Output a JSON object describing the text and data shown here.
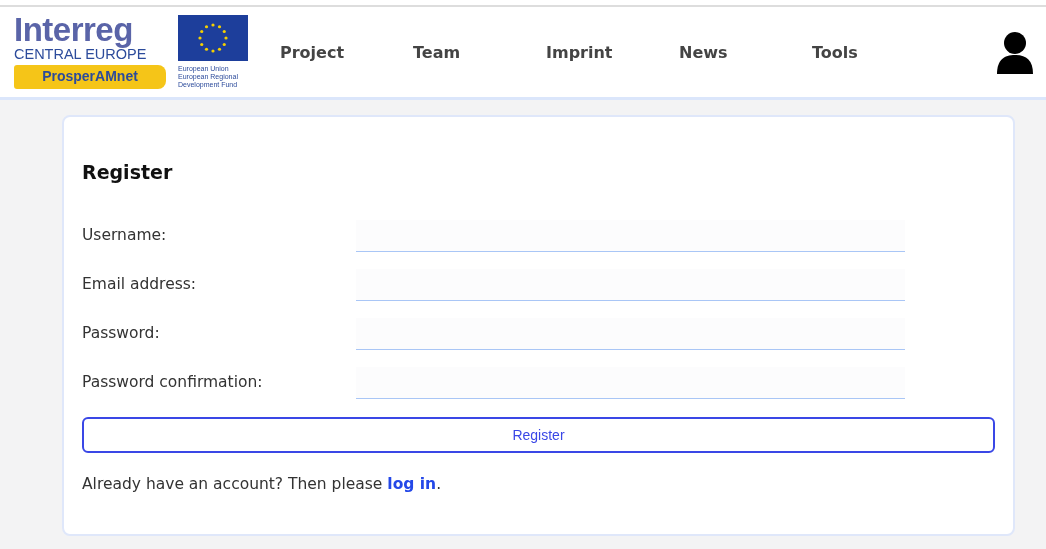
{
  "logo": {
    "title": "Interreg",
    "region": "CENTRAL EUROPE",
    "project": "ProsperAMnet",
    "eu_lines": [
      "European Union",
      "European Regional",
      "Development Fund"
    ]
  },
  "nav": [
    {
      "label": "Project"
    },
    {
      "label": "Team"
    },
    {
      "label": "Imprint"
    },
    {
      "label": "News"
    },
    {
      "label": "Tools"
    }
  ],
  "form": {
    "title": "Register",
    "fields": [
      {
        "label": "Username:"
      },
      {
        "label": "Email address:"
      },
      {
        "label": "Password:"
      },
      {
        "label": "Password confirmation:"
      }
    ],
    "submit": "Register",
    "login_prompt": {
      "before": "Already have an account? Then please ",
      "link": "log in",
      "after": "."
    }
  }
}
